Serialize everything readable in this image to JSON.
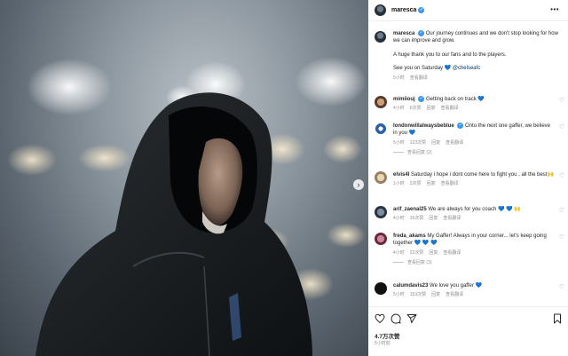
{
  "post": {
    "username": "maresca",
    "verified_mark": "✓",
    "more_label": "•••",
    "photo_next_label": "›"
  },
  "caption": {
    "username": "maresca",
    "line1": "Our journey continues and we don't stop looking for how we can improve and grow.",
    "line2": "A huge thank you to our fans and to the players.",
    "line3_text": "See you on Saturday",
    "line3_emoji": "💙",
    "mention": "@chelseafc",
    "time": "5小时",
    "translate": "查看翻译"
  },
  "comments": [
    {
      "username": "mimiiouj",
      "text": "Getting back on track 💙",
      "time": "4小时",
      "likes": "6次赞",
      "reply": "回复",
      "translate": "查看翻译"
    },
    {
      "username": "londonwillalwaysbeblue",
      "text": "Onto the next one gaffer, we believe in you 💙",
      "time": "5小时",
      "likes": "123次赞",
      "reply": "回复",
      "translate": "查看翻译",
      "replies": "查看回复 (2)"
    },
    {
      "username": "elvis4l",
      "text": "Saturday i hope i dont come here to fight you , all the best🙌",
      "time": "1小时",
      "likes": "2次赞",
      "reply": "回复",
      "translate": "查看翻译"
    },
    {
      "username": "arif_zaenal25",
      "text": "We are always for you coach 💙 💙 🙌",
      "time": "4小时",
      "likes": "16次赞",
      "reply": "回复",
      "translate": "查看翻译"
    },
    {
      "username": "freda_akams",
      "text": "My Gaffer! Always in your corner... let's keep going together 💙 💙 💙",
      "time": "4小时",
      "likes": "22次赞",
      "reply": "回复",
      "translate": "查看翻译",
      "replies": "查看回复 (3)"
    },
    {
      "username": "calumdavis23",
      "text": "We love you gaffer 💙",
      "time": "5小时",
      "likes": "153次赞",
      "reply": "回复",
      "translate": "查看翻译"
    }
  ],
  "footer": {
    "likes": "4.7万次赞",
    "time": "5小时前",
    "icons": [
      "heart-icon",
      "comment-icon",
      "share-icon",
      "bookmark-icon"
    ]
  },
  "colors": {
    "verified": "#3897f0",
    "mention": "#00376b",
    "muted": "#8e8e8e"
  }
}
